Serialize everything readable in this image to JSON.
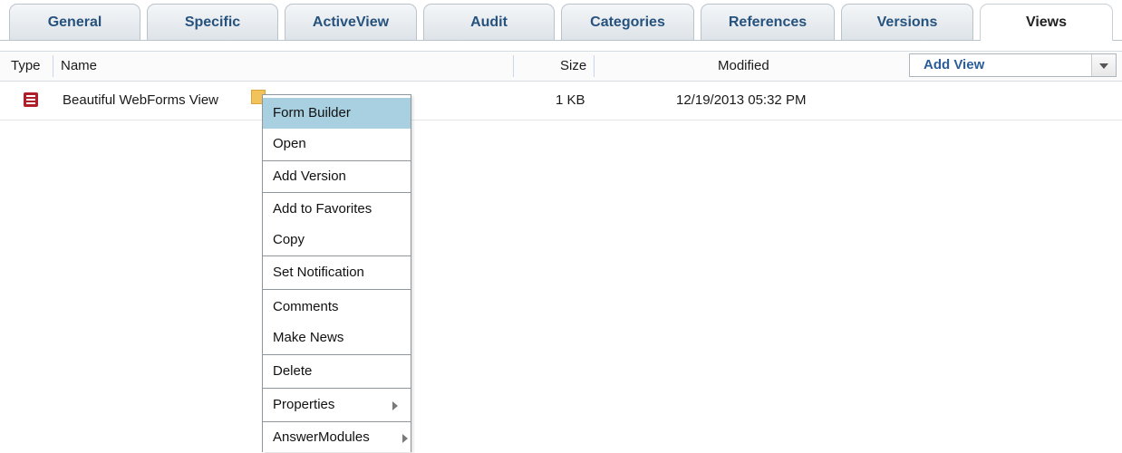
{
  "tabs": [
    {
      "label": "General",
      "active": false
    },
    {
      "label": "Specific",
      "active": false
    },
    {
      "label": "ActiveView",
      "active": false
    },
    {
      "label": "Audit",
      "active": false
    },
    {
      "label": "Categories",
      "active": false
    },
    {
      "label": "References",
      "active": false
    },
    {
      "label": "Versions",
      "active": false
    },
    {
      "label": "Views",
      "active": true
    }
  ],
  "columns": {
    "type": "Type",
    "name": "Name",
    "size": "Size",
    "modified": "Modified"
  },
  "add_view": {
    "label": "Add View"
  },
  "rows": [
    {
      "icon": "form-view-icon",
      "name": "Beautiful WebForms View",
      "size": "1 KB",
      "modified": "12/19/2013 05:32 PM"
    }
  ],
  "context_menu": {
    "items": [
      {
        "label": "Form Builder",
        "highlighted": true
      },
      {
        "label": "Open"
      },
      {
        "label": "Add Version"
      },
      {
        "label": "Add to Favorites"
      },
      {
        "label": "Copy"
      },
      {
        "label": "Set Notification"
      },
      {
        "label": "Comments"
      },
      {
        "label": "Make News"
      },
      {
        "label": "Delete"
      },
      {
        "label": "Properties",
        "submenu": true
      },
      {
        "label": "AnswerModules",
        "submenu": true
      }
    ]
  },
  "colors": {
    "tab_text": "#26527e",
    "highlight": "#a8d0e0",
    "type_icon": "#b01e2a"
  }
}
